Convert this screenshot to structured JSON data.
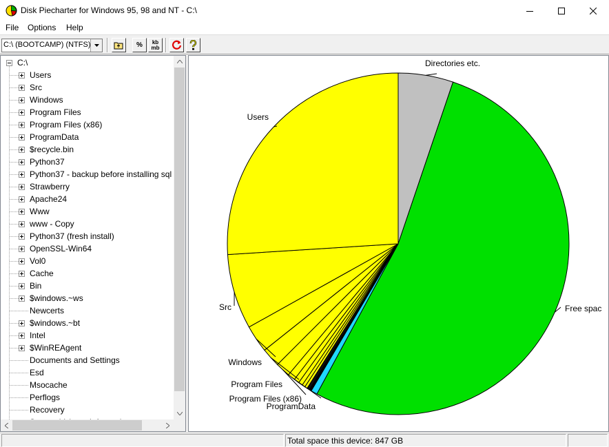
{
  "window": {
    "title": "Disk Piecharter for Windows 95, 98 and NT - C:\\"
  },
  "menu": {
    "file": "File",
    "options": "Options",
    "help": "Help"
  },
  "toolbar": {
    "drive_value": "C:\\ (BOOTCAMP) (NTFS)",
    "percent_label": "%",
    "kbmb_top": "kb",
    "kbmb_bottom": "mb"
  },
  "tree": {
    "root": "C:\\",
    "items": [
      {
        "label": "Users",
        "expandable": true
      },
      {
        "label": "Src",
        "expandable": true
      },
      {
        "label": "Windows",
        "expandable": true
      },
      {
        "label": "Program Files",
        "expandable": true
      },
      {
        "label": "Program Files (x86)",
        "expandable": true
      },
      {
        "label": "ProgramData",
        "expandable": true
      },
      {
        "label": "$recycle.bin",
        "expandable": true
      },
      {
        "label": "Python37",
        "expandable": true
      },
      {
        "label": "Python37 - backup before installing sql",
        "expandable": true
      },
      {
        "label": "Strawberry",
        "expandable": true
      },
      {
        "label": "Apache24",
        "expandable": true
      },
      {
        "label": "Www",
        "expandable": true
      },
      {
        "label": "www - Copy",
        "expandable": true
      },
      {
        "label": "Python37 (fresh install)",
        "expandable": true
      },
      {
        "label": "OpenSSL-Win64",
        "expandable": true
      },
      {
        "label": "Vol0",
        "expandable": true
      },
      {
        "label": "Cache",
        "expandable": true
      },
      {
        "label": "Bin",
        "expandable": true
      },
      {
        "label": "$windows.~ws",
        "expandable": true
      },
      {
        "label": "Newcerts",
        "expandable": false
      },
      {
        "label": "$windows.~bt",
        "expandable": true
      },
      {
        "label": "Intel",
        "expandable": true
      },
      {
        "label": "$WinREAgent",
        "expandable": true
      },
      {
        "label": "Documents and Settings",
        "expandable": false
      },
      {
        "label": "Esd",
        "expandable": false
      },
      {
        "label": "Msocache",
        "expandable": false
      },
      {
        "label": "Perflogs",
        "expandable": false
      },
      {
        "label": "Recovery",
        "expandable": false
      },
      {
        "label": "System Volume Information",
        "expandable": false
      }
    ]
  },
  "chart_data": {
    "type": "pie",
    "start_angle_deg": 0,
    "direction": "clockwise",
    "slices": [
      {
        "name": "Directories etc.",
        "percent": 5.2,
        "color": "#c0c0c0",
        "label": "Directories etc."
      },
      {
        "name": "Free space",
        "percent": 52.7,
        "color": "#00e000",
        "label": "Free spac"
      },
      {
        "name": "other-cyan",
        "percent": 0.6,
        "color": "#20d8ff",
        "label": ""
      },
      {
        "name": "other-dark-1",
        "percent": 0.2,
        "color": "#000000",
        "label": ""
      },
      {
        "name": "other-dark-2",
        "percent": 0.25,
        "color": "#101010",
        "label": ""
      },
      {
        "name": "small-yellow-1",
        "percent": 0.25,
        "color": "#ffff00",
        "label": ""
      },
      {
        "name": "small-yellow-2",
        "percent": 0.3,
        "color": "#ffff00",
        "label": ""
      },
      {
        "name": "small-yellow-3",
        "percent": 0.4,
        "color": "#ffff00",
        "label": ""
      },
      {
        "name": "small-yellow-4",
        "percent": 0.5,
        "color": "#ffff00",
        "label": ""
      },
      {
        "name": "ProgramData",
        "percent": 0.7,
        "color": "#ffff00",
        "label": "ProgramData"
      },
      {
        "name": "Program Files (x86)",
        "percent": 1.4,
        "color": "#ffff00",
        "label": "Program Files (x86)"
      },
      {
        "name": "Program Files",
        "percent": 1.8,
        "color": "#ffff00",
        "label": "Program Files"
      },
      {
        "name": "Windows",
        "percent": 2.6,
        "color": "#ffff00",
        "label": "Windows"
      },
      {
        "name": "Src",
        "percent": 7.1,
        "color": "#ffff00",
        "label": "Src"
      },
      {
        "name": "Users",
        "percent": 26.0,
        "color": "#ffff00",
        "label": "Users"
      }
    ]
  },
  "status": {
    "left": "",
    "total": "Total space this device: 847 GB",
    "right": ""
  },
  "colors": {
    "yellow": "#ffff00",
    "green": "#00e000",
    "gray": "#c0c0c0",
    "cyan": "#20d8ff"
  }
}
